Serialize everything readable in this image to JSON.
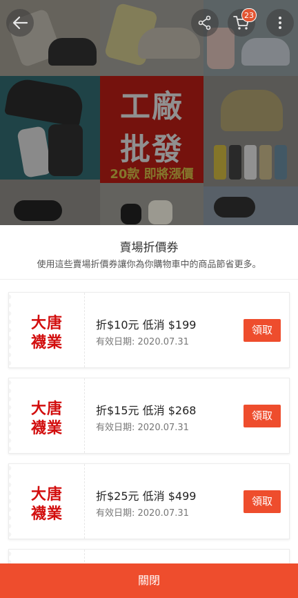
{
  "banner": {
    "promo_line1": "工廠",
    "promo_line2": "批發",
    "promo_line3": "20款 即將漲價",
    "cart_count": "23"
  },
  "icons": {
    "back": "back-arrow-icon",
    "share": "share-icon",
    "cart": "shopping-cart-icon",
    "more": "more-vertical-icon"
  },
  "sheet": {
    "title": "賣場折價券",
    "subtitle": "使用這些賣場折價券讓你為你購物車中的商品節省更多。"
  },
  "vouchers": [
    {
      "shop_line1": "大唐",
      "shop_line2": "襪業",
      "main": "折$10元 低消 $199",
      "date": "有效日期: 2020.07.31",
      "button": "領取"
    },
    {
      "shop_line1": "大唐",
      "shop_line2": "襪業",
      "main": "折$15元 低消 $268",
      "date": "有效日期: 2020.07.31",
      "button": "領取"
    },
    {
      "shop_line1": "大唐",
      "shop_line2": "襪業",
      "main": "折$25元 低消 $499",
      "date": "有效日期: 2020.07.31",
      "button": "領取"
    }
  ],
  "close_label": "關閉",
  "colors": {
    "accent": "#ee4d2d",
    "shop_logo_text": "#d20e0e"
  }
}
